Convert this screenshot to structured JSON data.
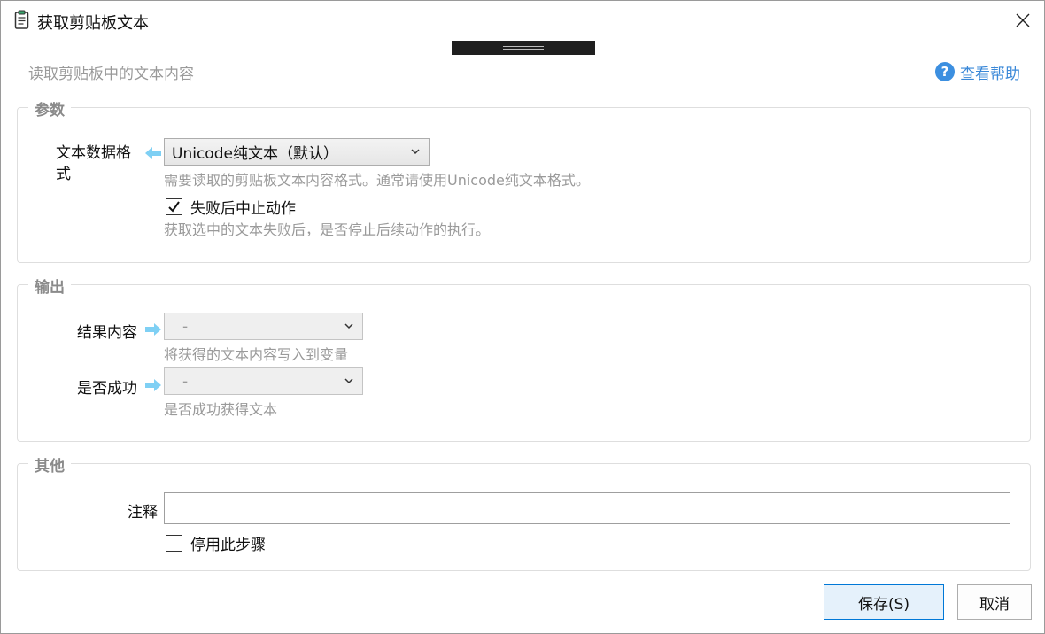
{
  "window": {
    "title": "获取剪贴板文本",
    "subtitle": "读取剪贴板中的文本内容",
    "help_label": "查看帮助",
    "title_icon": "clipboard-icon",
    "close_icon": "close-icon"
  },
  "params": {
    "legend": "参数",
    "format_label": "文本数据格式",
    "format_value": "Unicode纯文本（默认）",
    "format_hint": "需要读取的剪贴板文本内容格式。通常请使用Unicode纯文本格式。",
    "abort_label": "失败后中止动作",
    "abort_checked": true,
    "abort_hint": "获取选中的文本失败后，是否停止后续动作的执行。"
  },
  "output": {
    "legend": "输出",
    "result_label": "结果内容",
    "result_value": "-",
    "result_hint": "将获得的文本内容写入到变量",
    "success_label": "是否成功",
    "success_value": "-",
    "success_hint": "是否成功获得文本"
  },
  "other": {
    "legend": "其他",
    "comment_label": "注释",
    "comment_value": "",
    "disable_label": "停用此步骤",
    "disable_checked": false
  },
  "footer": {
    "save_label": "保存(S)",
    "cancel_label": "取消"
  },
  "colors": {
    "accent": "#0078d7",
    "help_blue": "#3a88d8",
    "arrow_blue": "#7fd0f4",
    "hint_gray": "#9a9a9a"
  }
}
